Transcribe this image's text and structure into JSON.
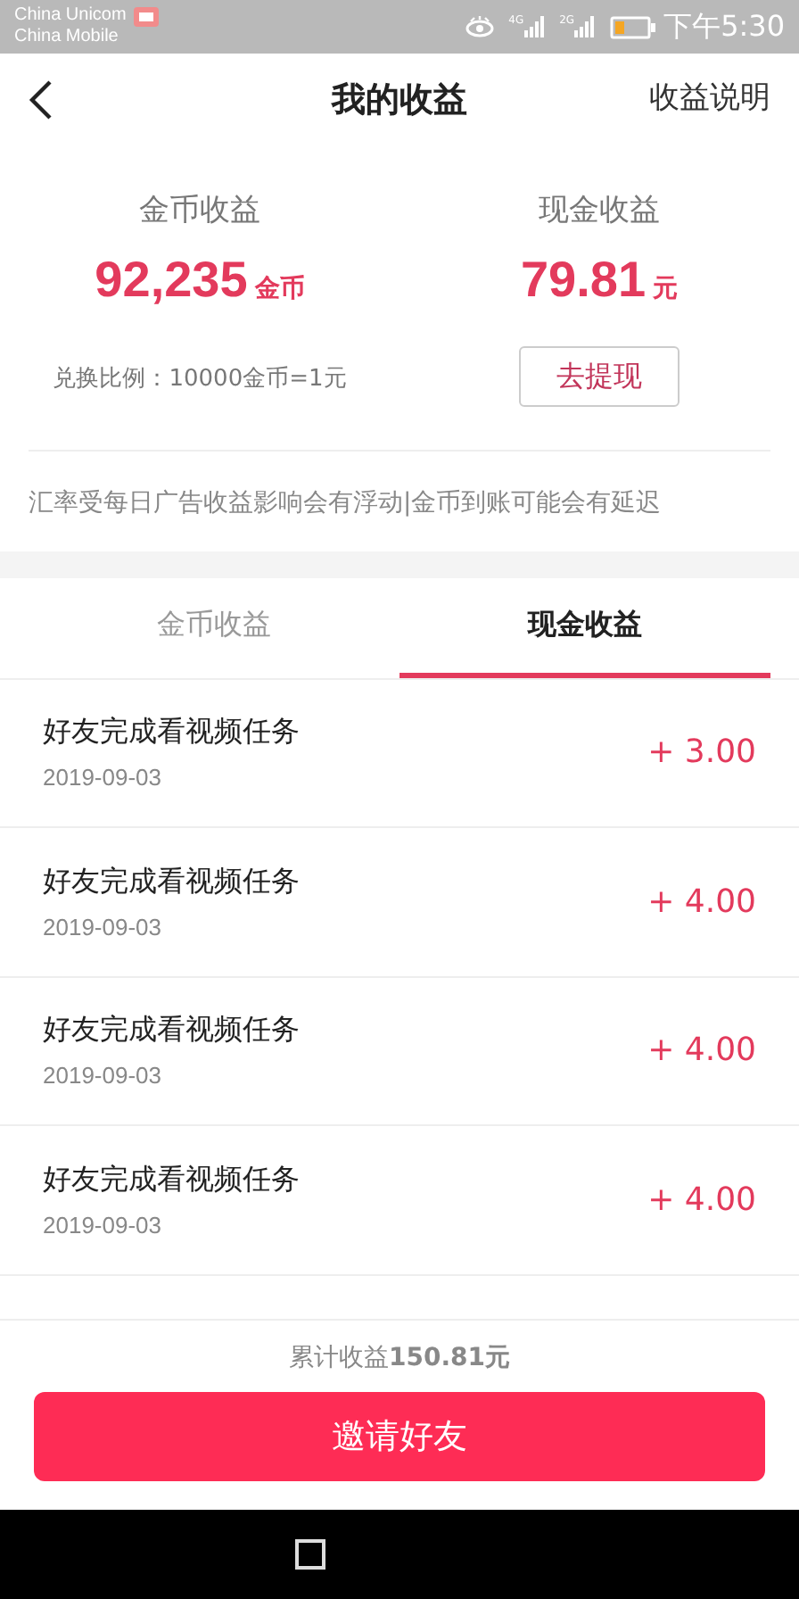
{
  "status_bar": {
    "carriers": [
      "China Unicom",
      "China Mobile"
    ],
    "network_labels": [
      "4G",
      "2G"
    ],
    "time": "下午5:30"
  },
  "header": {
    "title": "我的收益",
    "link": "收益说明"
  },
  "summary": [
    {
      "label": "金币收益",
      "amount": "92,235",
      "unit": "金币"
    },
    {
      "label": "现金收益",
      "amount": "79.81",
      "unit": "元"
    }
  ],
  "rate_note": "兑换比例：10000金币=1元",
  "withdraw_button": "去提现",
  "notice": "汇率受每日广告收益影响会有浮动|金币到账可能会有延迟",
  "tabs": [
    {
      "label": "金币收益",
      "selected": false
    },
    {
      "label": "现金收益",
      "selected": true
    }
  ],
  "records": [
    {
      "title": "好友完成看视频任务",
      "date": "2019-09-03",
      "amount": "+ 3.00"
    },
    {
      "title": "好友完成看视频任务",
      "date": "2019-09-03",
      "amount": "+ 4.00"
    },
    {
      "title": "好友完成看视频任务",
      "date": "2019-09-03",
      "amount": "+ 4.00"
    },
    {
      "title": "好友完成看视频任务",
      "date": "2019-09-03",
      "amount": "+ 4.00"
    }
  ],
  "total": "累计收益**150.81元**",
  "invite_button": "邀请好友"
}
